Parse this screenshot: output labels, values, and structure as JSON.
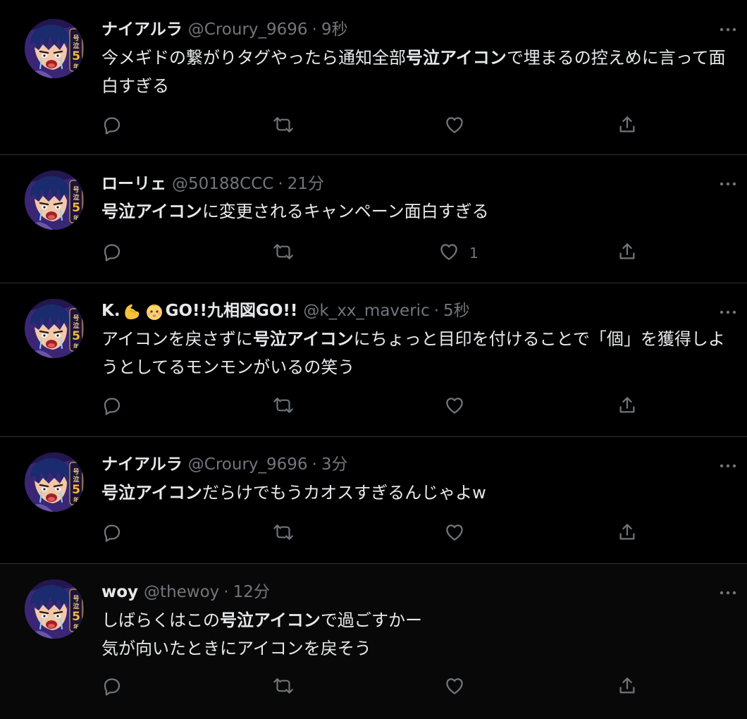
{
  "tweets": [
    {
      "name": "ナイアルラ",
      "handle": "@Croury_9696",
      "time": "9秒",
      "body_html": "今メギドの繋がりタグやったら通知全部<b>号泣アイコン</b>で埋まるの控えめに言って面白すぎる",
      "likes": ""
    },
    {
      "name": "ローリェ",
      "handle": "@50188CCC",
      "time": "21分",
      "body_html": "<b>号泣アイコン</b>に変更されるキャンペーン面白すぎる",
      "likes": "1"
    },
    {
      "name_parts": [
        "K.",
        "GO!!九相図GO!!"
      ],
      "name_emojis": [
        "flexed-biceps-emoji",
        "baby-face-emoji"
      ],
      "handle": "@k_xx_maveric",
      "time": "5秒",
      "body_html": "アイコンを戻さずに<b>号泣アイコン</b>にちょっと目印を付けることで「個」を獲得しようとしてるモンモンがいるの笑う",
      "likes": ""
    },
    {
      "name": "ナイアルラ",
      "handle": "@Croury_9696",
      "time": "3分",
      "body_html": "<b>号泣アイコン</b>だらけでもうカオスすぎるんじゃよw",
      "likes": ""
    },
    {
      "name": "woy",
      "handle": "@thewoy",
      "time": "12分",
      "body_html": "しばらくはこの<b>号泣アイコン</b>で過ごすかー<br>気が向いたときにアイコンを戻そう",
      "likes": ""
    }
  ],
  "separator": "·",
  "icons": {
    "reply": "reply-icon",
    "retweet": "retweet-icon",
    "like": "like-icon",
    "share": "share-icon",
    "more": "more-icon",
    "avatar_badge": "5"
  },
  "colors": {
    "background": "#000000",
    "text": "#e7e9ea",
    "secondary": "#71767b",
    "divider": "#2f3336",
    "avatar_purple": "#4a2e8c"
  }
}
